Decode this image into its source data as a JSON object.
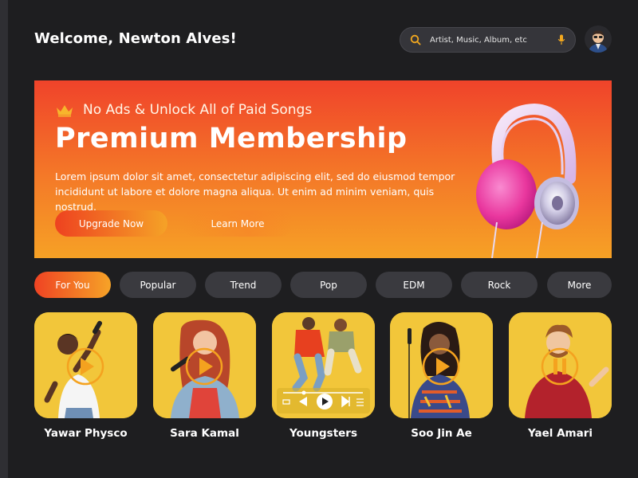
{
  "header": {
    "welcome": "Welcome, Newton Alves!",
    "search_placeholder": "Artist, Music, Album, etc"
  },
  "banner": {
    "subtitle": "No Ads & Unlock All of Paid Songs",
    "title": "Premium Membership",
    "description": "Lorem ipsum dolor sit amet, consectetur adipiscing elit, sed do eiusmod tempor incididunt ut labore et dolore magna aliqua. Ut enim ad minim veniam, quis nostrud.",
    "primary_button": "Upgrade Now",
    "secondary_button": "Learn More"
  },
  "chips": [
    {
      "label": "For You",
      "active": true
    },
    {
      "label": "Popular",
      "active": false
    },
    {
      "label": "Trend",
      "active": false
    },
    {
      "label": "Pop",
      "active": false
    },
    {
      "label": "EDM",
      "active": false
    },
    {
      "label": "Rock",
      "active": false
    },
    {
      "label": "More",
      "active": false
    }
  ],
  "artists": [
    {
      "name": "Yawar Physco"
    },
    {
      "name": "Sara Kamal"
    },
    {
      "name": "Youngsters"
    },
    {
      "name": "Soo Jin Ae"
    },
    {
      "name": "Yael Amari"
    }
  ],
  "colors": {
    "background": "#1e1e20",
    "accent_start": "#ef4323",
    "accent_end": "#f6a327",
    "card_bg": "#f2c63a",
    "chip_bg": "#3a3a3f"
  },
  "icons": [
    "search-icon",
    "mic-icon",
    "crown-icon",
    "play-icon",
    "pause-icon",
    "skip-icon",
    "repeat-icon"
  ]
}
